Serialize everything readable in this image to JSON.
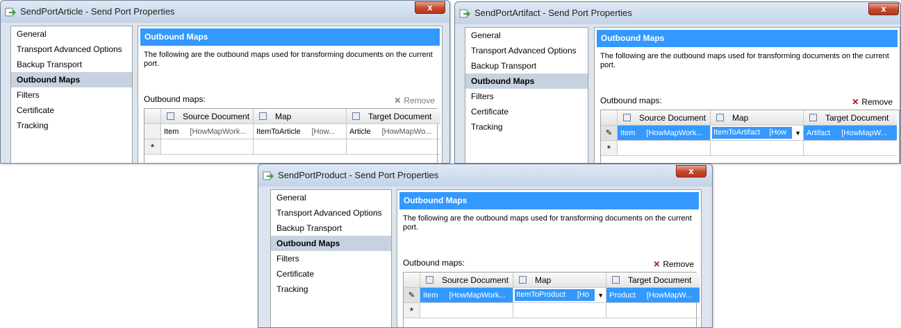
{
  "common": {
    "nav": [
      "General",
      "Transport Advanced Options",
      "Backup Transport",
      "Outbound Maps",
      "Filters",
      "Certificate",
      "Tracking"
    ],
    "header": "Outbound Maps",
    "description": "The following are the outbound maps used for transforming documents on the current port.",
    "maps_label": "Outbound maps:",
    "remove_label": "Remove",
    "columns": [
      "Source Document",
      "Map",
      "Target Document"
    ],
    "close_glyph": "x",
    "new_row_glyph": "*"
  },
  "windows": [
    {
      "title": "SendPortArticle - Send Port Properties",
      "row": {
        "source": "Item",
        "source_sub": "[HowMapWork...",
        "map": "ItemToArticle",
        "map_sub": "[How...",
        "target": "Article",
        "target_sub": "[HowMapWo..."
      }
    },
    {
      "title": "SendPortArtifact - Send Port Properties",
      "row": {
        "source": "Item",
        "source_sub": "[HowMapWork...",
        "map": "ItemToArtifact",
        "map_sub": "[How",
        "target": "Artifact",
        "target_sub": "[HowMapW..."
      }
    },
    {
      "title": "SendPortProduct - Send Port Properties",
      "row": {
        "source": "Item",
        "source_sub": "[HowMapWork...",
        "map": "ItemToProduct",
        "map_sub": "[Ho",
        "target": "Product",
        "target_sub": "[HowMapW..."
      }
    }
  ],
  "colors": {
    "accent": "#3399ff",
    "nav_selected": "#c6d2e0",
    "remove_x": "#a01818"
  }
}
